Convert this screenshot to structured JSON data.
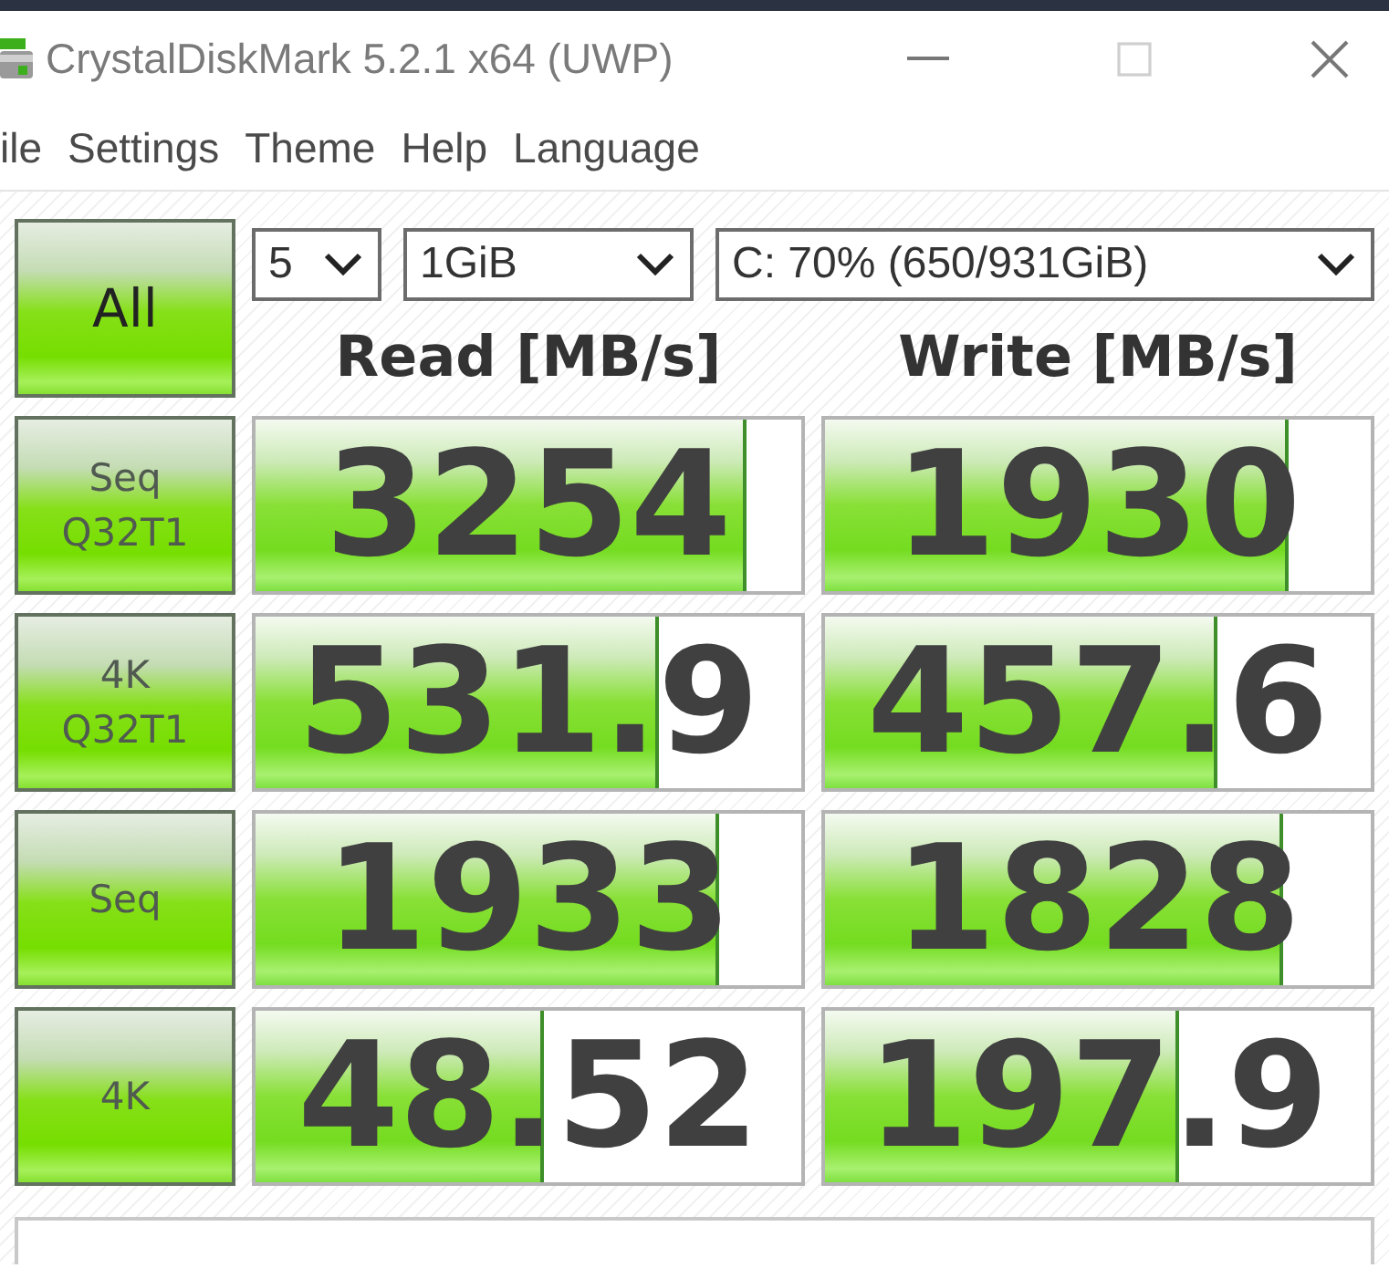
{
  "window": {
    "title": "CrystalDiskMark 5.2.1 x64 (UWP)"
  },
  "menu": [
    "ile",
    "Settings",
    "Theme",
    "Help",
    "Language"
  ],
  "all_button": {
    "label": "All"
  },
  "dropdowns": [
    {
      "kind": "count",
      "value": "5"
    },
    {
      "kind": "size",
      "value": "1GiB"
    },
    {
      "kind": "drive",
      "value": "C: 70% (650/931GiB)"
    }
  ],
  "columns": [
    "Read [MB/s]",
    "Write [MB/s]"
  ],
  "tests": [
    {
      "label": "Seq\nQ32T1",
      "read": {
        "value": "3254",
        "level": 0.9
      },
      "write": {
        "value": "1930",
        "level": 0.85
      }
    },
    {
      "label": "4K\nQ32T1",
      "read": {
        "value": "531.9",
        "level": 0.74
      },
      "write": {
        "value": "457.6",
        "level": 0.72
      }
    },
    {
      "label": "Seq",
      "read": {
        "value": "1933",
        "level": 0.85
      },
      "write": {
        "value": "1828",
        "level": 0.84
      }
    },
    {
      "label": "4K",
      "read": {
        "value": "48.52",
        "level": 0.53
      },
      "write": {
        "value": "197.9",
        "level": 0.65
      }
    }
  ]
}
